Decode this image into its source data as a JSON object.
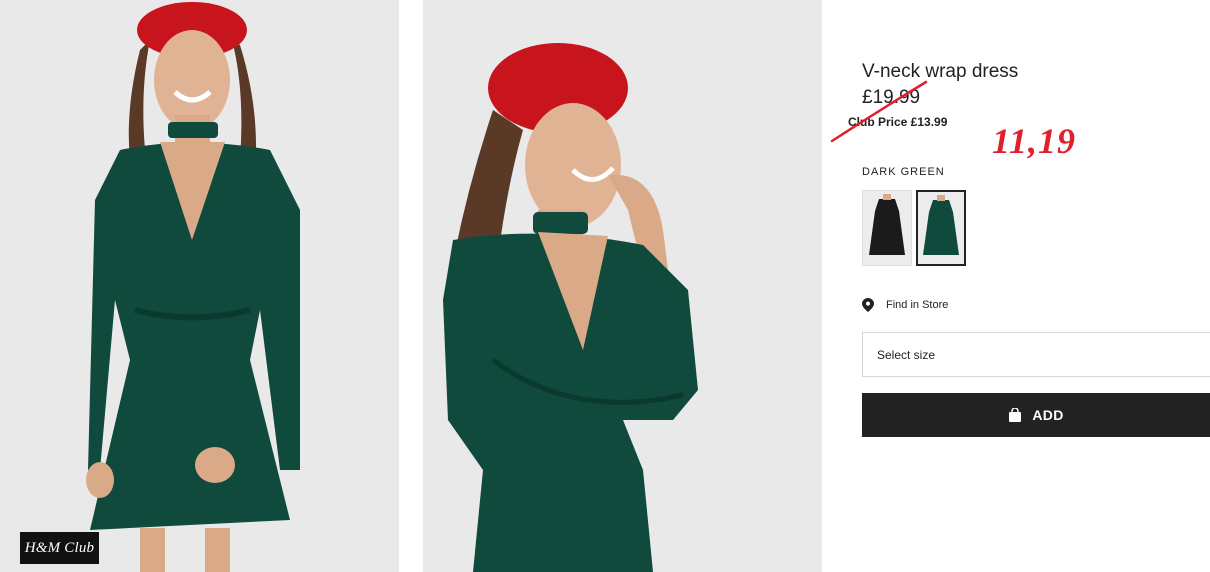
{
  "badge": {
    "label": "H&M Club"
  },
  "product": {
    "title": "V-neck wrap dress",
    "price": "£19.99",
    "club_price": "Club Price £13.99",
    "color_label": "DARK GREEN",
    "swatches": [
      {
        "name": "black",
        "color": "#1b1b1b"
      },
      {
        "name": "dark green",
        "color": "#0f4a3c",
        "selected": true
      }
    ]
  },
  "find_store": {
    "label": "Find in Store",
    "icon": "location-pin-icon"
  },
  "size_select": {
    "placeholder": "Select size"
  },
  "add_button": {
    "label": "ADD",
    "icon": "shopping-bag-icon"
  },
  "annotation": {
    "handwritten_price": "11,19",
    "color": "#e0202a"
  },
  "colors": {
    "dress": "#0f4a3c",
    "beret": "#c8141c",
    "photo_bg": "#e9e9ea",
    "button_bg": "#222222"
  }
}
